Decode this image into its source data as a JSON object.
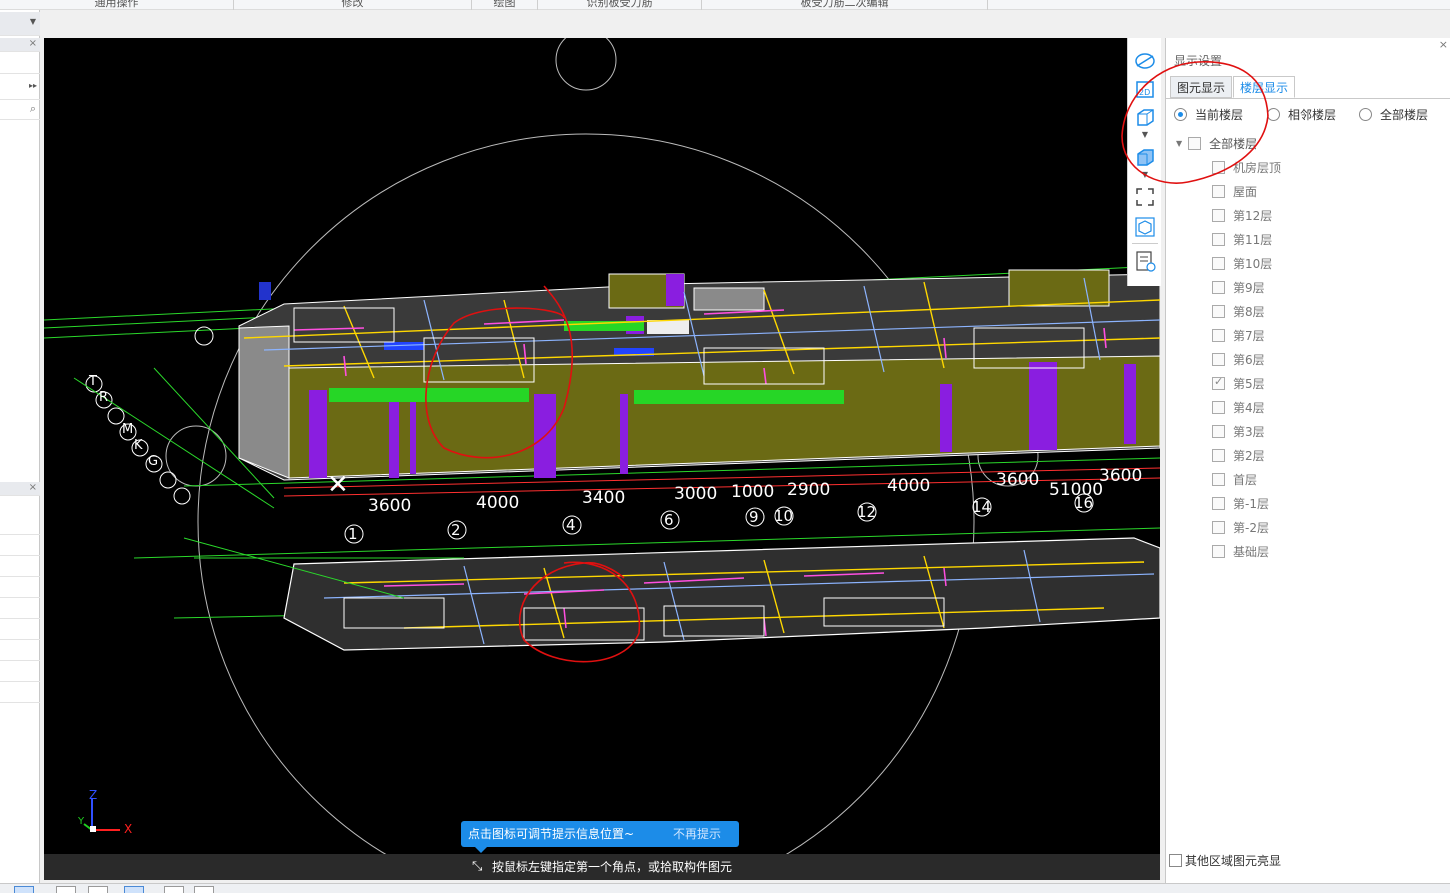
{
  "ribbon": {
    "groups": [
      "通用操作",
      "修改",
      "绘图",
      "识别板受力筋",
      "板受力筋二次编辑"
    ]
  },
  "viewport": {
    "axis_numbers_top": [
      "1",
      "2",
      "4",
      "6",
      "9",
      "10",
      "12",
      "14",
      "16"
    ],
    "dimensions": [
      "3600",
      "4000",
      "3400",
      "3000",
      "1000",
      "2900",
      "4000",
      "3600",
      "51000",
      "3600"
    ],
    "axis_letters": [
      "T",
      "R",
      "M",
      "K",
      "G"
    ],
    "axis_gizmo": {
      "z": "Z",
      "x": "X",
      "y": "Y"
    },
    "tooltip": {
      "text": "点击图标可调节提示信息位置~",
      "dismiss": "不再提示"
    },
    "status_prompt": "按鼠标左键指定第一个角点，或拾取构件图元"
  },
  "toolstrip": {
    "icons": [
      "orbit-icon",
      "2d-view-icon",
      "3d-box-icon",
      "3d-shaded-box-icon",
      "fullscreen-icon",
      "element-cube-icon",
      "display-settings-icon"
    ],
    "label_2d": "2D"
  },
  "display_settings": {
    "title": "显示设置",
    "close": "×",
    "tabs": [
      {
        "label": "图元显示",
        "active": false
      },
      {
        "label": "楼层显示",
        "active": true
      }
    ],
    "radios": [
      {
        "label": "当前楼层",
        "selected": true
      },
      {
        "label": "相邻楼层",
        "selected": false
      },
      {
        "label": "全部楼层",
        "selected": false
      }
    ],
    "tree_root": "全部楼层",
    "floors": [
      {
        "label": "机房层顶",
        "checked": false
      },
      {
        "label": "屋面",
        "checked": false
      },
      {
        "label": "第12层",
        "checked": false
      },
      {
        "label": "第11层",
        "checked": false
      },
      {
        "label": "第10层",
        "checked": false
      },
      {
        "label": "第9层",
        "checked": false
      },
      {
        "label": "第8层",
        "checked": false
      },
      {
        "label": "第7层",
        "checked": false
      },
      {
        "label": "第6层",
        "checked": false
      },
      {
        "label": "第5层",
        "checked": true
      },
      {
        "label": "第4层",
        "checked": false
      },
      {
        "label": "第3层",
        "checked": false
      },
      {
        "label": "第2层",
        "checked": false
      },
      {
        "label": "首层",
        "checked": false
      },
      {
        "label": "第-1层",
        "checked": false
      },
      {
        "label": "第-2层",
        "checked": false
      },
      {
        "label": "基础层",
        "checked": false
      }
    ],
    "other_region_option": "其他区域图元亮显"
  },
  "colors": {
    "accent": "#1c8ce8",
    "annotation_red": "#e01010",
    "wall_olive": "#6b6a14",
    "column_purple": "#8a1ee0",
    "slab_green": "#26d626",
    "beam_yellow": "#ffd800",
    "viewport_bg": "#000000"
  }
}
